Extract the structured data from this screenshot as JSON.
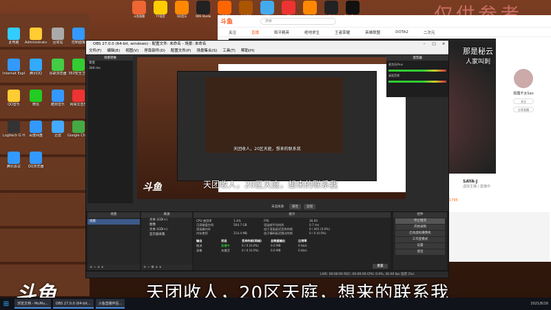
{
  "watermark": "仅供参考",
  "topbar_icons": [
    {
      "label": "斗鱼直播",
      "color": "#e63"
    },
    {
      "label": "Y.Y语音",
      "color": "#fc0"
    },
    {
      "label": "QQ音乐",
      "color": "#f80"
    },
    {
      "label": "OBS Studio",
      "color": "#222"
    },
    {
      "label": "快手直播",
      "color": "#f60"
    },
    {
      "label": "多多直播",
      "color": "#a50"
    },
    {
      "label": "迅雷",
      "color": "#4ae"
    },
    {
      "label": "CF",
      "color": "#e33"
    },
    {
      "label": "穿越火线",
      "color": "#f80"
    },
    {
      "label": "游戏",
      "color": "#222"
    },
    {
      "label": "Epic Games",
      "color": "#111"
    }
  ],
  "desktop_icons": [
    {
      "label": "此电脑",
      "color": "#3cf"
    },
    {
      "label": "Administrator",
      "color": "#fc3"
    },
    {
      "label": "回收站",
      "color": "#aaa"
    },
    {
      "label": "控制面板",
      "color": "#39f"
    },
    {
      "label": "Internet Explorer",
      "color": "#39f"
    },
    {
      "label": "腾讯QQ",
      "color": "#3af"
    },
    {
      "label": "谷歌浏览器",
      "color": "#4c4"
    },
    {
      "label": "360安全卫士",
      "color": "#3c3"
    },
    {
      "label": "QQ音乐",
      "color": "#fc3"
    },
    {
      "label": "微信",
      "color": "#2c2"
    },
    {
      "label": "酷狗音乐",
      "color": "#39f"
    },
    {
      "label": "网易云音乐",
      "color": "#e33"
    },
    {
      "label": "Logitech G HUB",
      "color": "#333"
    },
    {
      "label": "百度网盘",
      "color": "#39f"
    },
    {
      "label": "迅雷",
      "color": "#4af"
    },
    {
      "label": "Google Chrome",
      "color": "#4a4"
    },
    {
      "label": "腾讯会议",
      "color": "#39f"
    },
    {
      "label": "QQ浏览器",
      "color": "#39f"
    }
  ],
  "browser": {
    "logo": "斗鱼",
    "search_placeholder": "搜索",
    "nav": [
      "关注",
      "直播",
      "和平精英",
      "绝地求生",
      "王者荣耀",
      "英雄联盟",
      "DOTA2",
      "二次元"
    ],
    "active_nav": 1,
    "overlay_line1": "那是秘云",
    "overlay_line2": "人家叫刺",
    "streamer_name": "狐狸不太Sao",
    "follow_label": "关注",
    "share_label": "分享直播",
    "info_name": "SAYA·J",
    "info_sub": "虚拟主播 | 直播中",
    "info_count": "1795"
  },
  "obs": {
    "title": "OBS 27.0.0 (64-bit, windows) - 配置文件: 未命名 - 场景: 未命名",
    "menu": [
      "文件(F)",
      "编辑(E)",
      "视图(V)",
      "停靠部件(D)",
      "配置文件(P)",
      "场景集合(S)",
      "工具(T)",
      "帮助(H)"
    ],
    "left_header": "场景转换",
    "left_rows": [
      "渐变",
      "300 ms"
    ],
    "right_header": "混音器",
    "mixer": [
      {
        "name": "麦克风/Aux",
        "db": "0.0 dB"
      },
      {
        "name": "桌面音频",
        "db": "-18.1 dB"
      }
    ],
    "preview_subtitle": "天团收人，20区天庭，想来的联系我",
    "preview_logo": "斗鱼",
    "strip": [
      "属性",
      "滤镜"
    ],
    "selected_source_label": "未选择源",
    "scenes_header": "场景",
    "scenes": [
      "场景"
    ],
    "sources_header": "来源",
    "sources": [
      "文本 (GDI+)",
      "图像",
      "文本 (GDI+)",
      "显示器采集"
    ],
    "stats_header": "统计",
    "stats_grid": [
      [
        "CPU 使用率",
        "1.4%",
        "FPS",
        "30.00"
      ],
      [
        "可用磁盘空间",
        "504.7 GB",
        "渲染帧平均时间",
        "0.7 ms"
      ],
      [
        "渲染器内存",
        "",
        "由于渲染延迟丢失的帧",
        "0 / 401 (0.0%)"
      ],
      [
        "内存使用",
        "214.4 MB",
        "由于编码延迟跳过的帧",
        "0 / 0 (0.0%)"
      ]
    ],
    "stats_table_head": [
      "输出",
      "状态",
      "丢弃的帧(网络)",
      "总数据输出",
      "比特率"
    ],
    "stats_table_rows": [
      [
        "推流",
        "直播中",
        "0 / 0 (0.0%)",
        "0.0 MB",
        "0 kb/s"
      ],
      [
        "录像",
        "未激活",
        "0 / 0 (0.0%)",
        "0.0 MB",
        "0 kb/s"
      ]
    ],
    "reset_label": "重置",
    "controls_header": "控件",
    "controls": [
      "停止推流",
      "开始录制",
      "启动虚拟摄像机",
      "工作室模式",
      "设置",
      "退出"
    ],
    "status": "LIVE: 00:00:00    REC: 00:00:00    CPU: 0.0%, 30.00 fps    延迟 (5s)"
  },
  "big_subtitle": "天团收人，20区天庭，想来的联系我",
  "big_logo": "斗鱼",
  "taskbar": {
    "items": [
      "浏览文档 - MuMu...",
      "OBS 27.0.0 (64-bit...",
      "斗鱼直播伴侣..."
    ],
    "clock_time": "",
    "clock_date": "2021/8/16"
  }
}
